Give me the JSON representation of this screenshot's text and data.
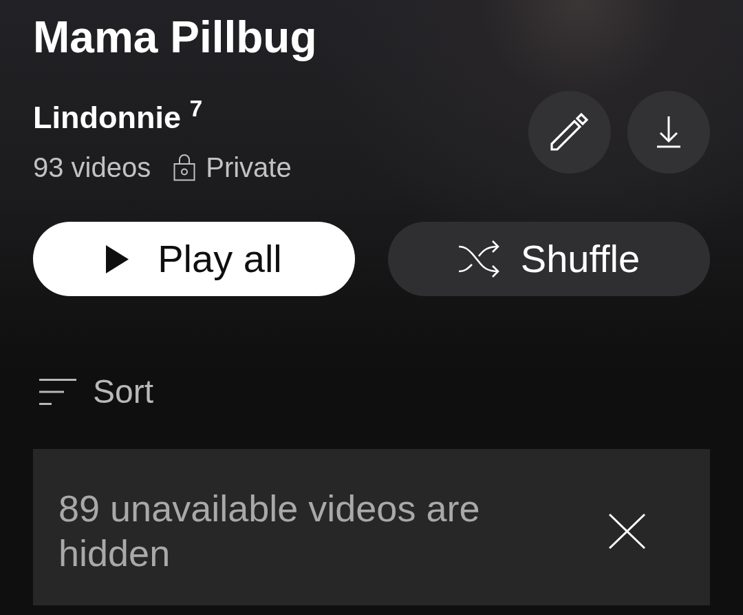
{
  "playlist": {
    "title": "Mama Pillbug",
    "owner": "Lindonnie $^{7}$",
    "video_count": "93 videos",
    "privacy": "Private"
  },
  "buttons": [
    {
      "kind": "play",
      "label": "Play all"
    },
    {
      "kind": "shuffle",
      "label": "Shuffle"
    }
  ],
  "sort": {
    "label": "Sort"
  },
  "notice": {
    "text": "89 unavailable videos are hidden"
  }
}
